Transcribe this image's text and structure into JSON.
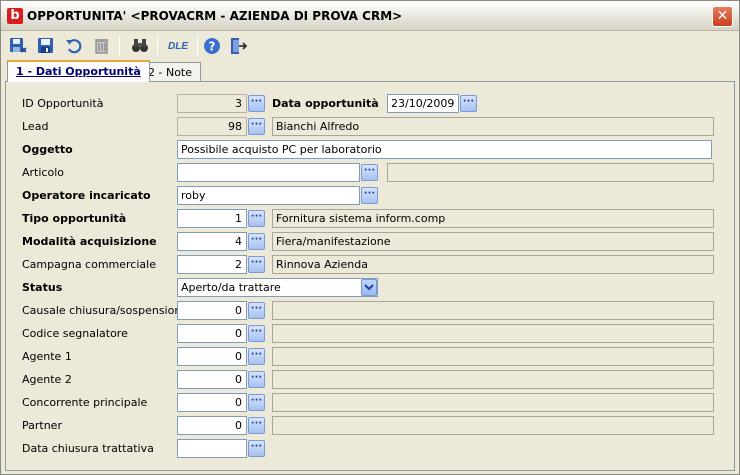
{
  "window": {
    "title": "OPPORTUNITA' <PROVACRM - AZIENDA DI PROVA CRM>",
    "app_icon": "b"
  },
  "toolbar": {
    "icons": [
      "new-record-icon",
      "save-icon",
      "undo-icon",
      "delete-icon",
      "search-binoculars-icon",
      "dle-icon",
      "help-icon",
      "exit-icon"
    ],
    "dle_label": "DLE"
  },
  "tabs": [
    {
      "label": "1 - Dati Opportunità",
      "active": true
    },
    {
      "label": "2 - Note",
      "active": false
    }
  ],
  "form": {
    "id_label": "ID Opportunità",
    "id_value": "3",
    "data_label": "Data opportunità",
    "data_value": "23/10/2009",
    "lead_label": "Lead",
    "lead_value": "98",
    "lead_name": "Bianchi Alfredo",
    "oggetto_label": "Oggetto",
    "oggetto_value": "Possibile acquisto PC per laboratorio",
    "articolo_label": "Articolo",
    "articolo_value": "",
    "articolo_desc": "",
    "operatore_label": "Operatore incaricato",
    "operatore_value": "roby",
    "tipo_label": "Tipo opportunità",
    "tipo_value": "1",
    "tipo_desc": "Fornitura sistema inform.comp",
    "modalita_label": "Modalità acquisizione",
    "modalita_value": "4",
    "modalita_desc": "Fiera/manifestazione",
    "campagna_label": "Campagna commerciale",
    "campagna_value": "2",
    "campagna_desc": "Rinnova Azienda",
    "status_label": "Status",
    "status_value": "Aperto/da trattare",
    "causale_label": "Causale chiusura/sospensione",
    "causale_value": "0",
    "codice_label": "Codice segnalatore",
    "codice_value": "0",
    "agente1_label": "Agente 1",
    "agente1_value": "0",
    "agente2_label": "Agente 2",
    "agente2_value": "0",
    "concorrente_label": "Concorrente principale",
    "concorrente_value": "0",
    "partner_label": "Partner",
    "partner_value": "0",
    "data_chiusura_label": "Data chiusura trattativa",
    "data_chiusura_value": ""
  },
  "dots_label": "···"
}
